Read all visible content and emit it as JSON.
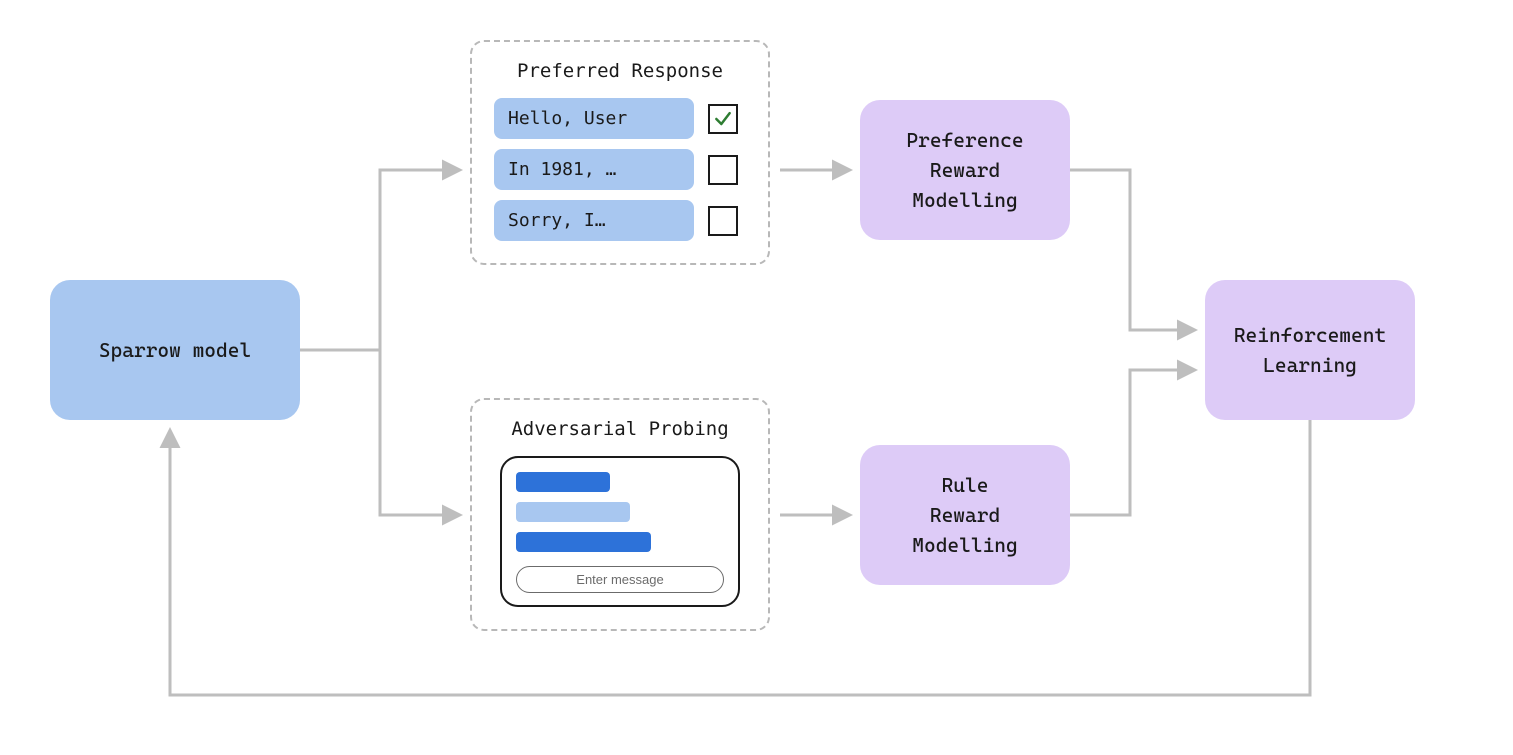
{
  "nodes": {
    "sparrow": "Sparrow model",
    "preference_rm": "Preference\nReward\nModelling",
    "rule_rm": "Rule\nReward\nModelling",
    "rl": "Reinforcement\nLearning"
  },
  "panels": {
    "preferred": {
      "title": "Preferred Response",
      "responses": [
        {
          "text": "Hello, User",
          "checked": true
        },
        {
          "text": "In 1981, …",
          "checked": false
        },
        {
          "text": "Sorry, I…",
          "checked": false
        }
      ]
    },
    "adversarial": {
      "title": "Adversarial Probing",
      "input_placeholder": "Enter message"
    }
  },
  "colors": {
    "blue_node": "#A8C7F0",
    "purple_node": "#DDCBF7",
    "arrow": "#BEBEBE",
    "bar_dark": "#2D72D9",
    "bar_light": "#A8C7F0",
    "check": "#2E7D32"
  }
}
